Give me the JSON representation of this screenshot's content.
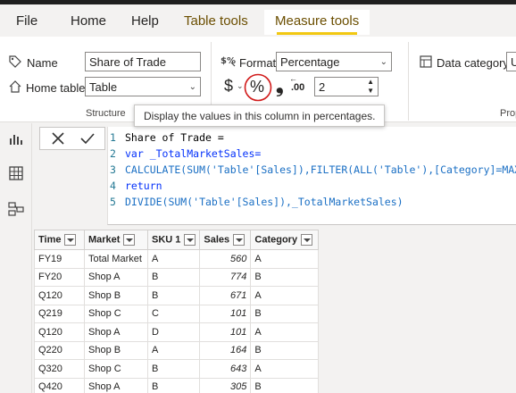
{
  "menu": {
    "tabs": [
      "File",
      "Home",
      "Help",
      "Table tools",
      "Measure tools"
    ]
  },
  "ribbon": {
    "name_label": "Name",
    "name_value": "Share of Trade",
    "home_table_label": "Home table",
    "home_table_value": "Table",
    "structure_group": "Structure",
    "format_label": "Format",
    "format_value": "Percentage",
    "currency_symbol": "$",
    "percent_symbol": "%",
    "comma_symbol": "❟",
    "decimal_symbol": ".00",
    "decimal_places": "2",
    "data_category_label": "Data category",
    "data_category_value": "U",
    "properties_group": "Prop"
  },
  "tooltip": "Display the values in this column in percentages.",
  "formula": {
    "lines": [
      "Share of Trade =",
      "var _TotalMarketSales=",
      "CALCULATE(SUM('Table'[Sales]),FILTER(ALL('Table'),[Category]=MAX('T",
      "return",
      "DIVIDE(SUM('Table'[Sales]),_TotalMarketSales)"
    ]
  },
  "table": {
    "columns": [
      "Time",
      "Market",
      "SKU 1",
      "Sales",
      "Category"
    ],
    "rows": [
      [
        "FY19",
        "Total Market",
        "A",
        "560",
        "A"
      ],
      [
        "FY20",
        "Shop A",
        "B",
        "774",
        "B"
      ],
      [
        "Q120",
        "Shop B",
        "B",
        "671",
        "A"
      ],
      [
        "Q219",
        "Shop C",
        "C",
        "101",
        "B"
      ],
      [
        "Q120",
        "Shop A",
        "D",
        "101",
        "A"
      ],
      [
        "Q220",
        "Shop B",
        "A",
        "164",
        "B"
      ],
      [
        "Q320",
        "Shop C",
        "B",
        "643",
        "A"
      ],
      [
        "Q420",
        "Shop A",
        "B",
        "305",
        "B"
      ]
    ]
  },
  "colors": {
    "accent": "#f2c811",
    "highlight_circle": "#d11b1b"
  }
}
